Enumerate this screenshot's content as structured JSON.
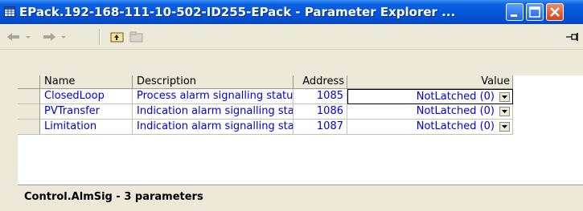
{
  "window": {
    "title": "EPack.192-168-111-10-502-ID255-EPack - Parameter Explorer ..."
  },
  "toolbar": {
    "icons": [
      "back-arrow-icon",
      "forward-arrow-icon",
      "parent-folder-icon",
      "folder-icon",
      "pin-icon"
    ]
  },
  "grid": {
    "columns": {
      "name": "Name",
      "description": "Description",
      "address": "Address",
      "value": "Value"
    },
    "rows": [
      {
        "name": "ClosedLoop",
        "description": "Process alarm signalling statu",
        "address": "1085",
        "value": "NotLatched (0)"
      },
      {
        "name": "PVTransfer",
        "description": "Indication alarm signalling sta",
        "address": "1086",
        "value": "NotLatched (0)"
      },
      {
        "name": "Limitation",
        "description": "Indication alarm signalling sta",
        "address": "1087",
        "value": "NotLatched (0)"
      }
    ]
  },
  "status": {
    "text": "Control.AlmSig  -  3 parameters"
  },
  "colors": {
    "title_bar": "#0655d8",
    "link_text": "#0000dd",
    "chrome": "#ece9d8",
    "close_button": "#d4411a"
  }
}
